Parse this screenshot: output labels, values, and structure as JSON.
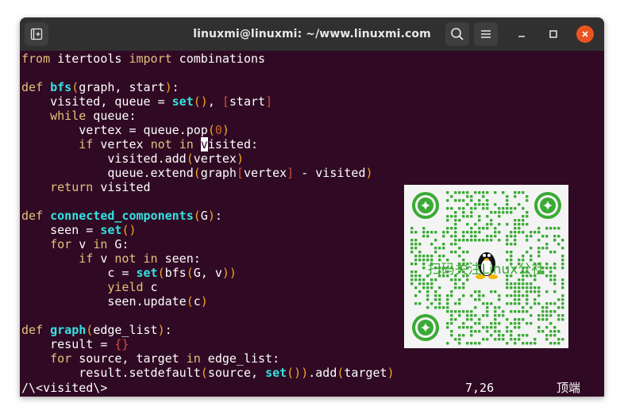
{
  "window": {
    "title": "linuxmi@linuxmi: ~/www.linuxmi.com",
    "buttons": [
      "new-tab",
      "search",
      "menu",
      "minimize",
      "maximize",
      "close"
    ]
  },
  "code": [
    [
      [
        "kw",
        "from"
      ],
      [
        "t",
        " itertools "
      ],
      [
        "kw",
        "import"
      ],
      [
        "t",
        " combinations"
      ]
    ],
    [],
    [
      [
        "kw",
        "def"
      ],
      [
        "t",
        " "
      ],
      [
        "fn",
        "bfs"
      ],
      [
        "par",
        "("
      ],
      [
        "t",
        "graph, start"
      ],
      [
        "par",
        ")"
      ],
      [
        "t",
        ":"
      ]
    ],
    [
      [
        "t",
        "    visited, queue = "
      ],
      [
        "bi",
        "set"
      ],
      [
        "par",
        "()"
      ],
      [
        "t",
        ", "
      ],
      [
        "brk",
        "["
      ],
      [
        "t",
        "start"
      ],
      [
        "brk",
        "]"
      ]
    ],
    [
      [
        "t",
        "    "
      ],
      [
        "kw",
        "while"
      ],
      [
        "t",
        " queue:"
      ]
    ],
    [
      [
        "t",
        "        vertex = queue.pop"
      ],
      [
        "par",
        "("
      ],
      [
        "num",
        "0"
      ],
      [
        "par",
        ")"
      ]
    ],
    [
      [
        "t",
        "        "
      ],
      [
        "kw",
        "if"
      ],
      [
        "t",
        " vertex "
      ],
      [
        "kw",
        "not"
      ],
      [
        "t",
        " "
      ],
      [
        "kw",
        "in"
      ],
      [
        "t",
        " "
      ],
      [
        "cur",
        "v"
      ],
      [
        "t",
        "isited:"
      ]
    ],
    [
      [
        "t",
        "            visited.add"
      ],
      [
        "par",
        "("
      ],
      [
        "t",
        "vertex"
      ],
      [
        "par",
        ")"
      ]
    ],
    [
      [
        "t",
        "            queue.extend"
      ],
      [
        "par",
        "("
      ],
      [
        "t",
        "graph"
      ],
      [
        "brk",
        "["
      ],
      [
        "t",
        "vertex"
      ],
      [
        "brk",
        "]"
      ],
      [
        "t",
        " - visited"
      ],
      [
        "par",
        ")"
      ]
    ],
    [
      [
        "t",
        "    "
      ],
      [
        "kw",
        "return"
      ],
      [
        "t",
        " visited"
      ]
    ],
    [],
    [
      [
        "kw",
        "def"
      ],
      [
        "t",
        " "
      ],
      [
        "fn",
        "connected_components"
      ],
      [
        "par",
        "("
      ],
      [
        "t",
        "G"
      ],
      [
        "par",
        ")"
      ],
      [
        "t",
        ":"
      ]
    ],
    [
      [
        "t",
        "    seen = "
      ],
      [
        "bi",
        "set"
      ],
      [
        "par",
        "()"
      ]
    ],
    [
      [
        "t",
        "    "
      ],
      [
        "kw",
        "for"
      ],
      [
        "t",
        " v "
      ],
      [
        "kw",
        "in"
      ],
      [
        "t",
        " G:"
      ]
    ],
    [
      [
        "t",
        "        "
      ],
      [
        "kw",
        "if"
      ],
      [
        "t",
        " v "
      ],
      [
        "kw",
        "not"
      ],
      [
        "t",
        " "
      ],
      [
        "kw",
        "in"
      ],
      [
        "t",
        " seen:"
      ]
    ],
    [
      [
        "t",
        "            c = "
      ],
      [
        "bi",
        "set"
      ],
      [
        "par",
        "("
      ],
      [
        "t",
        "bfs"
      ],
      [
        "par",
        "("
      ],
      [
        "t",
        "G, v"
      ],
      [
        "par",
        "))"
      ]
    ],
    [
      [
        "t",
        "            "
      ],
      [
        "kw",
        "yield"
      ],
      [
        "t",
        " c"
      ]
    ],
    [
      [
        "t",
        "            seen.update"
      ],
      [
        "par",
        "("
      ],
      [
        "t",
        "c"
      ],
      [
        "par",
        ")"
      ]
    ],
    [],
    [
      [
        "kw",
        "def"
      ],
      [
        "t",
        " "
      ],
      [
        "fn",
        "graph"
      ],
      [
        "par",
        "("
      ],
      [
        "t",
        "edge_list"
      ],
      [
        "par",
        ")"
      ],
      [
        "t",
        ":"
      ]
    ],
    [
      [
        "t",
        "    result = "
      ],
      [
        "brk",
        "{}"
      ]
    ],
    [
      [
        "t",
        "    "
      ],
      [
        "kw",
        "for"
      ],
      [
        "t",
        " source, target "
      ],
      [
        "kw",
        "in"
      ],
      [
        "t",
        " edge_list:"
      ]
    ],
    [
      [
        "t",
        "        result.setdefault"
      ],
      [
        "par",
        "("
      ],
      [
        "t",
        "source, "
      ],
      [
        "bi",
        "set"
      ],
      [
        "par",
        "())"
      ],
      [
        "t",
        ".add"
      ],
      [
        "par",
        "("
      ],
      [
        "t",
        "target"
      ],
      [
        "par",
        ")"
      ]
    ]
  ],
  "status": {
    "search": "/\\<visited\\>",
    "position": "7,26",
    "scroll": "顶端"
  },
  "qr": {
    "caption": "扫码关注Linux公社"
  }
}
